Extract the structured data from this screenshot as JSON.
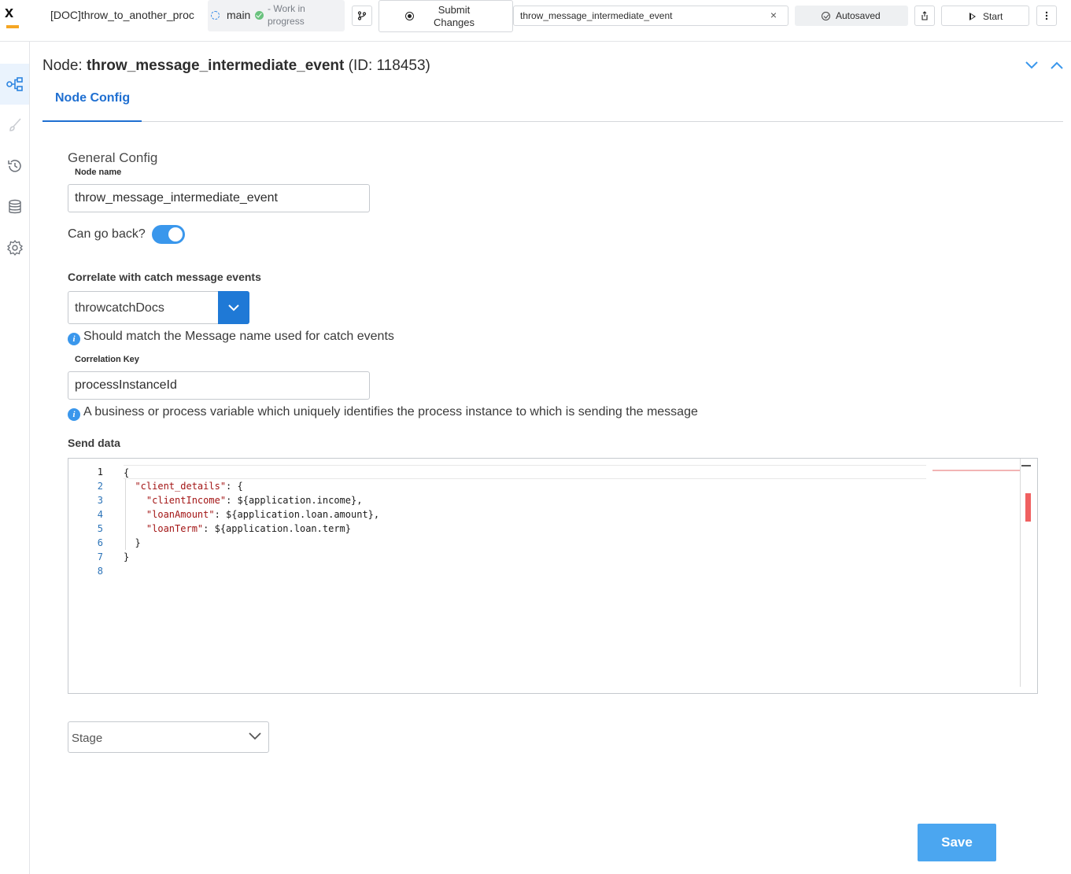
{
  "topbar": {
    "logo": "x-logo",
    "doc_title": "[DOC]throw_to_another_proc",
    "branch": "main",
    "status": "- Work in progress",
    "submit_label": "Submit Changes",
    "search_value": "throw_message_intermediate_event",
    "clear_icon": "×",
    "autosaved_label": "Autosaved",
    "start_label": "Start"
  },
  "rail": {
    "items": [
      "process-flow-icon",
      "brush-icon",
      "history-icon",
      "database-icon",
      "settings-icon"
    ],
    "active_index": 0
  },
  "node": {
    "prefix": "Node:",
    "name": "throw_message_intermediate_event",
    "id_text": "(ID: 118453)"
  },
  "tabs": [
    {
      "label": "Node Config",
      "active": true
    }
  ],
  "general": {
    "title": "General Config",
    "node_name_label": "Node name",
    "node_name_value": "throw_message_intermediate_event",
    "can_go_back_label": "Can go back?",
    "can_go_back": true
  },
  "correlate": {
    "label": "Correlate with catch message events",
    "value": "throwcatchDocs",
    "hint": "Should match the Message name used for catch events",
    "key_label": "Correlation Key",
    "key_value": "processInstanceId",
    "key_hint": "A business or process variable which uniquely identifies the process instance to which is sending the message"
  },
  "send_data": {
    "label": "Send data",
    "line_numbers": [
      "1",
      "2",
      "3",
      "4",
      "5",
      "6",
      "7",
      "8"
    ],
    "lines": [
      "{",
      "  \"client_details\": {",
      "    \"clientIncome\": ${application.income},",
      "    \"loanAmount\": ${application.loan.amount},",
      "    \"loanTerm\": ${application.loan.term}",
      "  }",
      "}",
      ""
    ]
  },
  "stage": {
    "placeholder": "Stage"
  },
  "actions": {
    "save_label": "Save"
  },
  "colors": {
    "accent": "#1f6fd1",
    "toggle": "#3a97ec",
    "save": "#4ba6f0",
    "json_key": "#a31515"
  }
}
